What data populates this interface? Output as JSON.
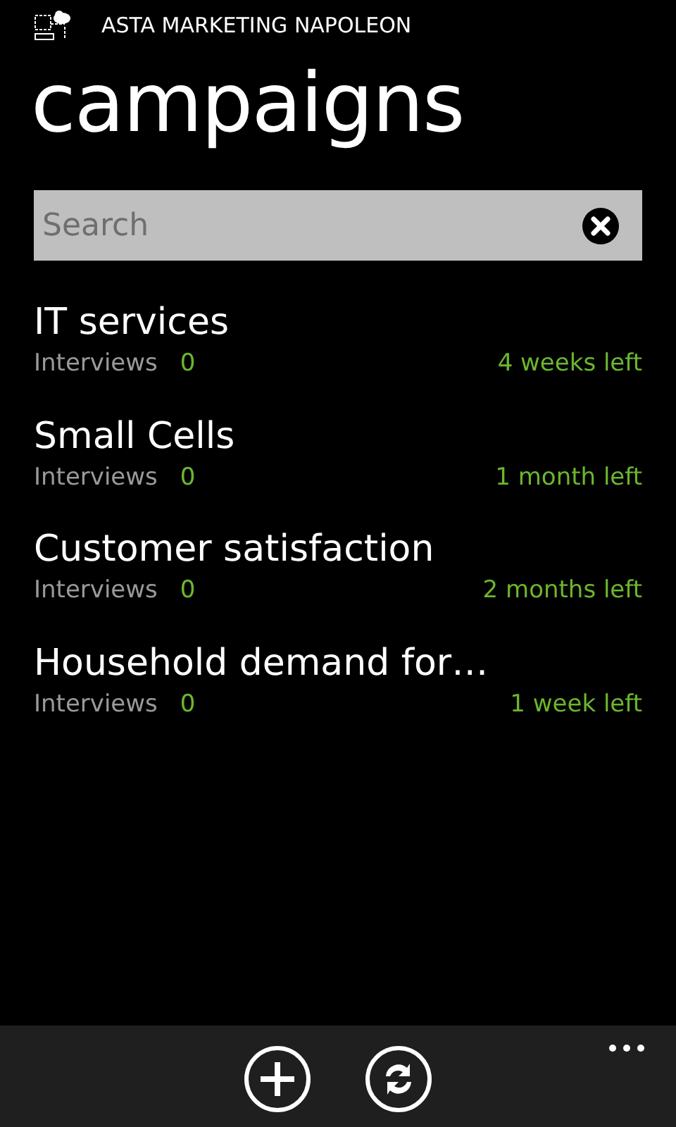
{
  "app_title": "ASTA MARKETING NAPOLEON",
  "page_title": "campaigns",
  "search": {
    "placeholder": "Search"
  },
  "campaigns": [
    {
      "name": "IT services",
      "interviews_label": "Interviews",
      "interviews": "0",
      "remaining": "4 weeks left"
    },
    {
      "name": "Small Cells",
      "interviews_label": "Interviews",
      "interviews": "0",
      "remaining": "1 month left"
    },
    {
      "name": "Customer satisfaction",
      "interviews_label": "Interviews",
      "interviews": "0",
      "remaining": "2 months left"
    },
    {
      "name": "Household demand for…",
      "interviews_label": "Interviews",
      "interviews": "0",
      "remaining": "1 week left"
    }
  ],
  "app_bar": {
    "buttons": [
      {
        "kind": "add"
      },
      {
        "kind": "sync"
      }
    ]
  }
}
